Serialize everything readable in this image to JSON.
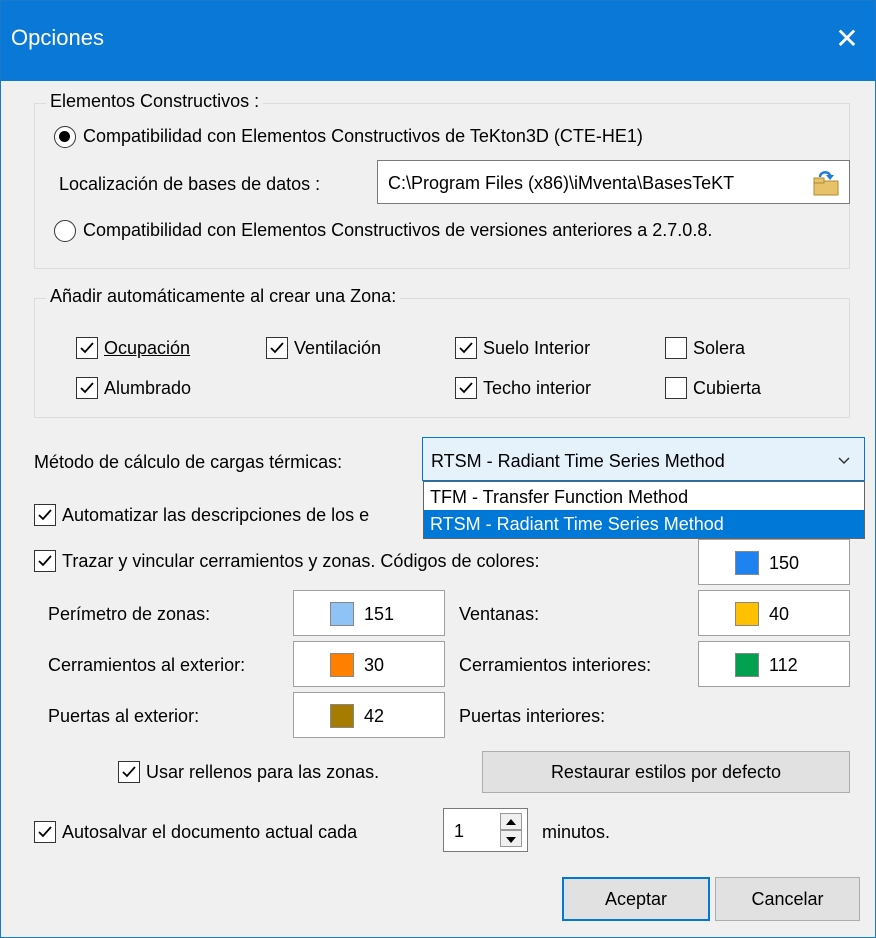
{
  "window": {
    "title": "Opciones",
    "close_glyph": "✕"
  },
  "constructive": {
    "legend": "Elementos Constructivos :",
    "option_new": "Compatibilidad con Elementos Constructivos de TeKton3D (CTE-HE1)",
    "db_label": "Localización de bases de datos :",
    "db_path": "C:\\Program Files (x86)\\iMventa\\BasesTeKT",
    "option_old": "Compatibilidad con Elementos Constructivos de versiones anteriores a 2.7.0.8.",
    "selected": "new"
  },
  "zone": {
    "legend": "Añadir automáticamente al crear una Zona:",
    "items": [
      {
        "label": "Ocupación",
        "checked": true
      },
      {
        "label": "Ventilación",
        "checked": true
      },
      {
        "label": "Suelo Interior",
        "checked": true
      },
      {
        "label": "Solera",
        "checked": false
      },
      {
        "label": "Alumbrado",
        "checked": true
      },
      {
        "label": "Techo interior",
        "checked": true
      },
      {
        "label": "Cubierta",
        "checked": false
      }
    ]
  },
  "thermal": {
    "label": "Método de cálculo de cargas térmicas:",
    "selected": "RTSM - Radiant Time Series Method",
    "options": [
      "TFM - Transfer Function Method",
      "RTSM - Radiant Time Series Method"
    ],
    "highlighted_index": 1
  },
  "automate": {
    "label": "Automatizar las descripciones de los e",
    "checked": true
  },
  "trace": {
    "label": "Trazar y vincular cerramientos y zonas. Códigos de colores:",
    "checked": true,
    "color": "#1e82f0",
    "code": "150"
  },
  "colors": {
    "perimeter": {
      "label": "Perímetro de zonas:",
      "color": "#8fc2f5",
      "code": "151"
    },
    "windows": {
      "label": "Ventanas:",
      "color": "#ffc000",
      "code": "40"
    },
    "ext_walls": {
      "label": "Cerramientos al exterior:",
      "color": "#ff8000",
      "code": "30"
    },
    "int_walls": {
      "label": "Cerramientos interiores:",
      "color": "#00a050",
      "code": "112"
    },
    "ext_doors": {
      "label": "Puertas al exterior:",
      "color": "#a67c00",
      "code": "42"
    },
    "int_doors": {
      "label": "Puertas interiores:"
    }
  },
  "fills": {
    "label": "Usar rellenos para las zonas.",
    "checked": true
  },
  "restore_button": "Restaurar estilos por defecto",
  "autosave": {
    "label": "Autosalvar el documento actual cada",
    "checked": true,
    "value": "1",
    "unit": "minutos."
  },
  "buttons": {
    "accept": "Aceptar",
    "cancel": "Cancelar"
  }
}
